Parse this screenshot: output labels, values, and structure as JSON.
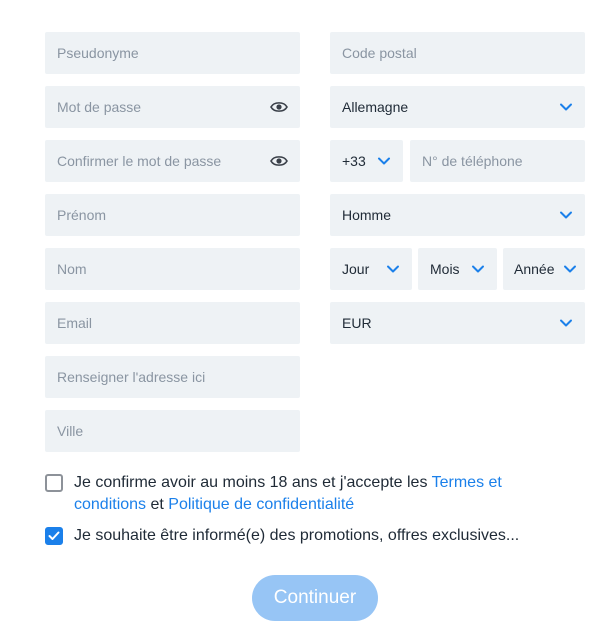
{
  "left_fields": {
    "username": "Pseudonyme",
    "password": "Mot de passe",
    "confirm_password": "Confirmer le mot de passe",
    "first_name": "Prénom",
    "last_name": "Nom",
    "email": "Email",
    "address": "Renseigner l'adresse ici",
    "city": "Ville"
  },
  "right_fields": {
    "postal_code": "Code postal",
    "country": "Allemagne",
    "dial_code": "+33",
    "phone": "N° de téléphone",
    "gender": "Homme",
    "dob_day": "Jour",
    "dob_month": "Mois",
    "dob_year": "Année",
    "currency": "EUR"
  },
  "icons": {
    "eye": "eye-icon",
    "chevron": "chevron-down-icon",
    "check": "check-icon"
  },
  "consent": {
    "terms_text": "Je confirme avoir au moins 18 ans et j'accepte les",
    "terms_link": "Termes et conditions",
    "and": "et",
    "privacy_link": "Politique de confidentialité",
    "terms_checked": false,
    "promo_text": "Je souhaite être informé(e) des promotions, offres exclusives...",
    "promo_checked": true
  },
  "submit": {
    "label": "Continuer"
  },
  "colors": {
    "accent": "#1b80ea",
    "field_bg": "#eef2f5",
    "button_bg": "#97c5f5",
    "placeholder": "#8a95a2"
  }
}
